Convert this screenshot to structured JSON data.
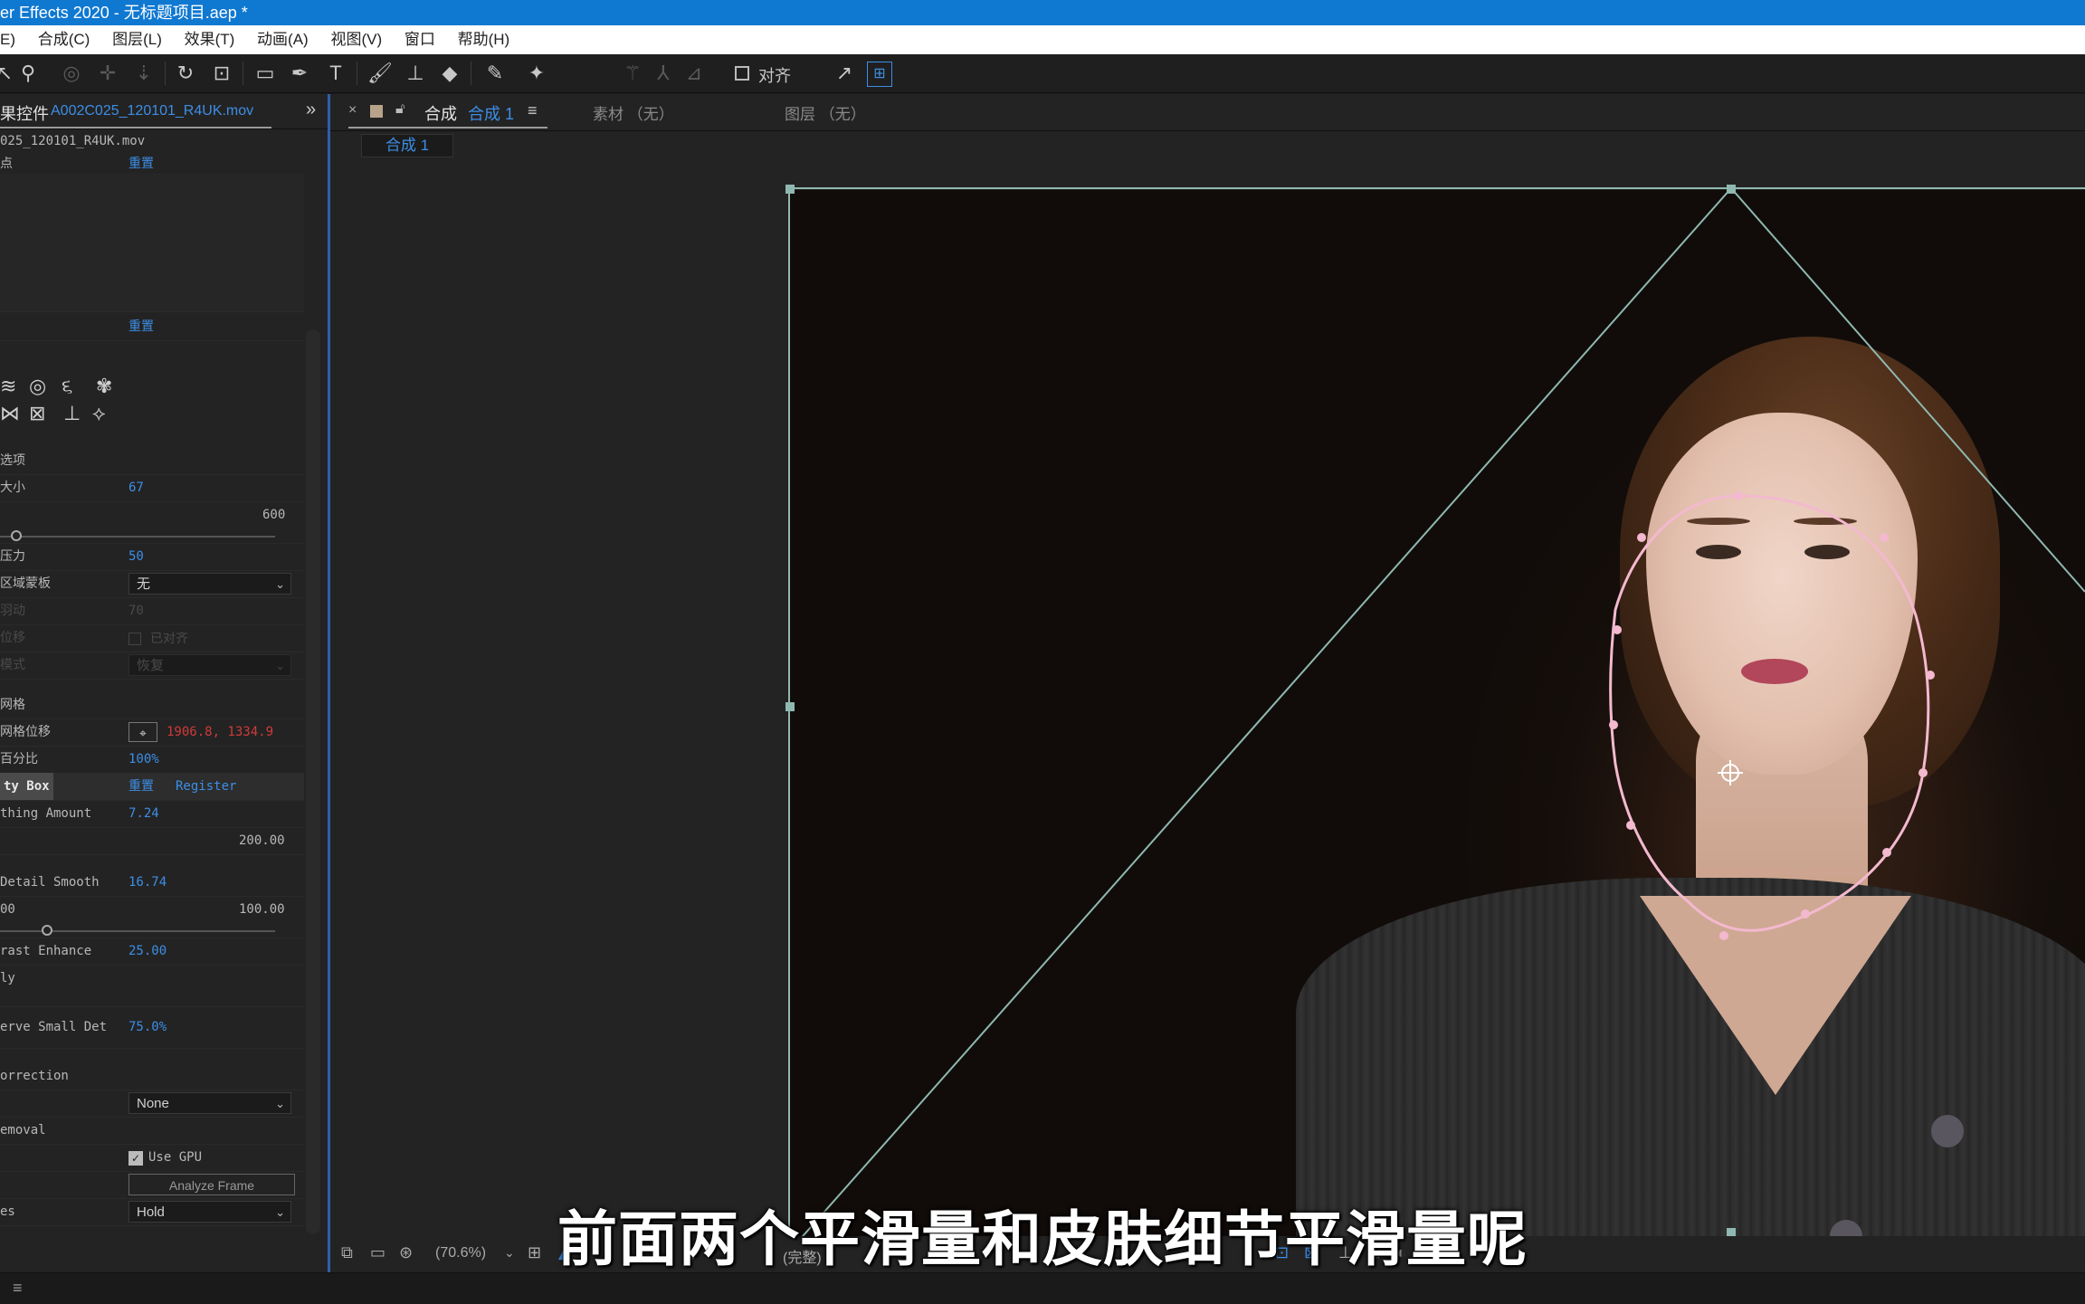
{
  "window": {
    "title": "er Effects 2020 - 无标题项目.aep *"
  },
  "menubar": {
    "items": [
      "E)",
      "合成(C)",
      "图层(L)",
      "效果(T)",
      "动画(A)",
      "视图(V)",
      "窗口",
      "帮助(H)"
    ]
  },
  "toolbar": {
    "align_label": "对齐"
  },
  "effect_controls": {
    "tab_title": "果控件",
    "tab_file": "A002C025_120101_R4UK.mov",
    "source_file": "025_120101_R4UK.mov",
    "rows": [
      {
        "label": "点",
        "value": "重置"
      },
      {
        "label": "",
        "value": "重置"
      },
      {
        "label": "选项",
        "value": ""
      },
      {
        "label": "大小",
        "value": "67"
      },
      {
        "label": "",
        "value": "600"
      },
      {
        "label": "压力",
        "value": "50"
      },
      {
        "label": "区域蒙板",
        "value": "无"
      },
      {
        "label": "羽动",
        "value": "70"
      },
      {
        "label": "位移",
        "value": "已对齐"
      },
      {
        "label": "模式",
        "value": "恢复"
      },
      {
        "label": "网格",
        "value": ""
      },
      {
        "label": "网格位移",
        "value": "1906.8, 1334.9"
      },
      {
        "label": "百分比",
        "value": "100%"
      },
      {
        "label": "ty Box",
        "value": "重置",
        "extra": "Register"
      },
      {
        "label": "thing Amount",
        "value": "7.24"
      },
      {
        "label": "",
        "value": "200.00"
      },
      {
        "label": "Detail Smooth",
        "value": "16.74"
      },
      {
        "label": "00",
        "value": "100.00"
      },
      {
        "label": "rast Enhance",
        "value": "25.00"
      },
      {
        "label": "ly",
        "value": ""
      },
      {
        "label": "erve Small Det",
        "value": "75.0%"
      },
      {
        "label": "orrection",
        "value": ""
      },
      {
        "label": "",
        "value": "None"
      },
      {
        "label": "emoval",
        "value": ""
      },
      {
        "label": "",
        "value": "Use GPU"
      },
      {
        "label": "",
        "value": "Analyze Frame"
      },
      {
        "label": "es",
        "value": "Hold"
      }
    ],
    "slider_levels": {
      "brush_size": 0.06,
      "detail_smooth": 0.17
    }
  },
  "composition": {
    "tab_close": "×",
    "tab_prefix": "合成",
    "tab_name": "合成 1",
    "footage_tab": "素材 （无）",
    "layer_tab": "图层 （无）",
    "subtab": "合成 1"
  },
  "bottom_bar": {
    "zoom": "(70.6%)",
    "resolution": "(完整)"
  },
  "subtitle": "前面两个平滑量和皮肤细节平滑量呢",
  "colors": {
    "title_bar": "#0f78d1",
    "accent_blue": "#3d8ee6",
    "mask_pink": "#f3b9cf",
    "guide_line": "#8fb8b0",
    "red_value": "#d03a3a"
  }
}
